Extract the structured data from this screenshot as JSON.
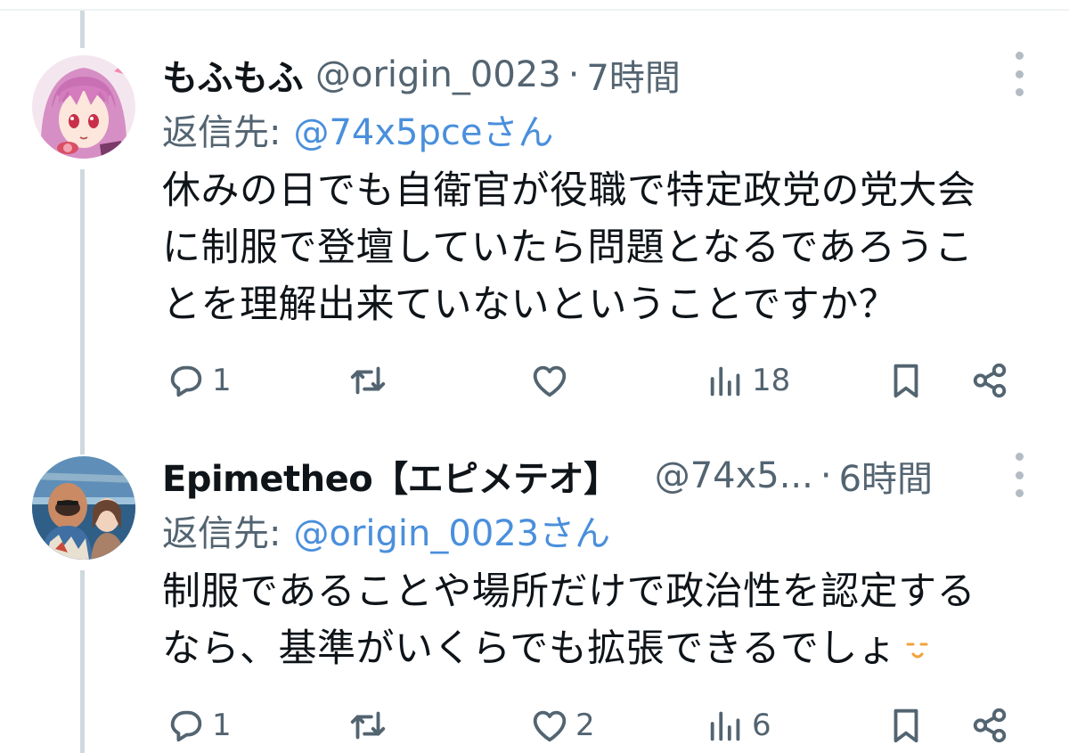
{
  "colors": {
    "text": "#0f1419",
    "muted": "#536471",
    "link": "#4a8fdc",
    "thread_line": "#cfd9de"
  },
  "tweets": [
    {
      "display_name": "もふもふ",
      "handle": "@origin_0023",
      "separator": "·",
      "time": "7時間",
      "reply_prefix": "返信先:",
      "reply_mention": "@74x5pceさん",
      "body_lines": [
        "休みの日でも自衛官が役職で特定政党の党大会",
        "に制服で登壇していたら問題となるであろうこ",
        "とを理解出来ていないということですか？"
      ],
      "actions": {
        "reply_count": "1",
        "retweet_count": "",
        "like_count": "",
        "views_count": "18"
      }
    },
    {
      "display_name": "Epimetheo【エピメテオ】",
      "handle": "@74x5...",
      "separator": "·",
      "time": "6時間",
      "reply_prefix": "返信先:",
      "reply_mention": "@origin_0023さん",
      "body_lines": [
        "制服であることや場所だけで政治性を認定する",
        "なら、基準がいくらでも拡張できるでしょ"
      ],
      "actions": {
        "reply_count": "1",
        "retweet_count": "",
        "like_count": "2",
        "views_count": "6"
      }
    }
  ],
  "icons": [
    "reply-icon",
    "retweet-icon",
    "like-icon",
    "views-icon",
    "bookmark-icon",
    "share-icon",
    "more-icon"
  ]
}
